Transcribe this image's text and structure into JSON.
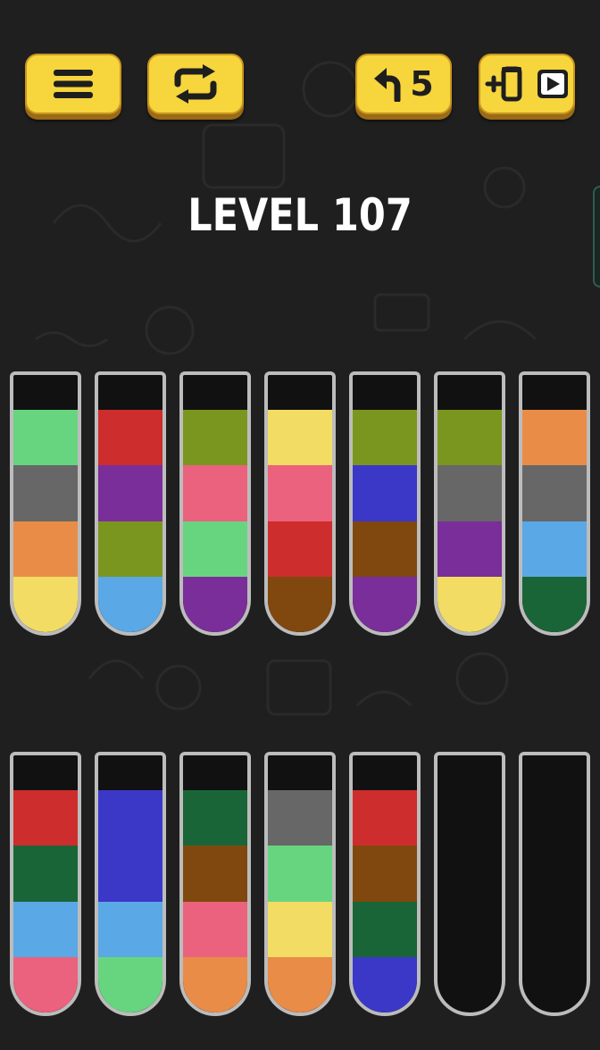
{
  "level": {
    "title": "LEVEL 107"
  },
  "toolbar": {
    "menu_icon": "hamburger-menu-icon",
    "restart_icon": "restart-arrows-icon",
    "undo_icon": "undo-arrow-icon",
    "undo_count": "5",
    "add_tube_icon": "add-tube-video-icon"
  },
  "colors": {
    "button": "#f6d53d",
    "background": "#1f1f1f",
    "tube_border": "#bcbcbc"
  },
  "palette": {
    "mint": "#67d57f",
    "gray": "#676767",
    "orange": "#e98c47",
    "yellow": "#f2dc63",
    "red": "#cd2d2c",
    "purple": "#7a2e99",
    "olive": "#7b961f",
    "lightblue": "#5aa8e5",
    "pink": "#ea627d",
    "brown": "#80480f",
    "blue": "#3b38c7",
    "darkgreen": "#1a6537"
  },
  "tubes": [
    {
      "id": 1,
      "layers": [
        "mint",
        "gray",
        "orange",
        "yellow"
      ]
    },
    {
      "id": 2,
      "layers": [
        "red",
        "purple",
        "olive",
        "lightblue"
      ]
    },
    {
      "id": 3,
      "layers": [
        "olive",
        "pink",
        "mint",
        "purple"
      ]
    },
    {
      "id": 4,
      "layers": [
        "yellow",
        "pink",
        "red",
        "brown"
      ]
    },
    {
      "id": 5,
      "layers": [
        "olive",
        "blue",
        "brown",
        "purple"
      ]
    },
    {
      "id": 6,
      "layers": [
        "olive",
        "gray",
        "purple",
        "yellow"
      ]
    },
    {
      "id": 7,
      "layers": [
        "orange",
        "gray",
        "lightblue",
        "darkgreen"
      ]
    },
    {
      "id": 8,
      "layers": [
        "red",
        "darkgreen",
        "lightblue",
        "pink"
      ]
    },
    {
      "id": 9,
      "layers": [
        "blue",
        "blue",
        "lightblue",
        "mint"
      ]
    },
    {
      "id": 10,
      "layers": [
        "darkgreen",
        "brown",
        "pink",
        "orange"
      ]
    },
    {
      "id": 11,
      "layers": [
        "gray",
        "mint",
        "yellow",
        "orange"
      ]
    },
    {
      "id": 12,
      "layers": [
        "red",
        "brown",
        "darkgreen",
        "blue"
      ]
    },
    {
      "id": 13,
      "layers": []
    },
    {
      "id": 14,
      "layers": []
    }
  ]
}
